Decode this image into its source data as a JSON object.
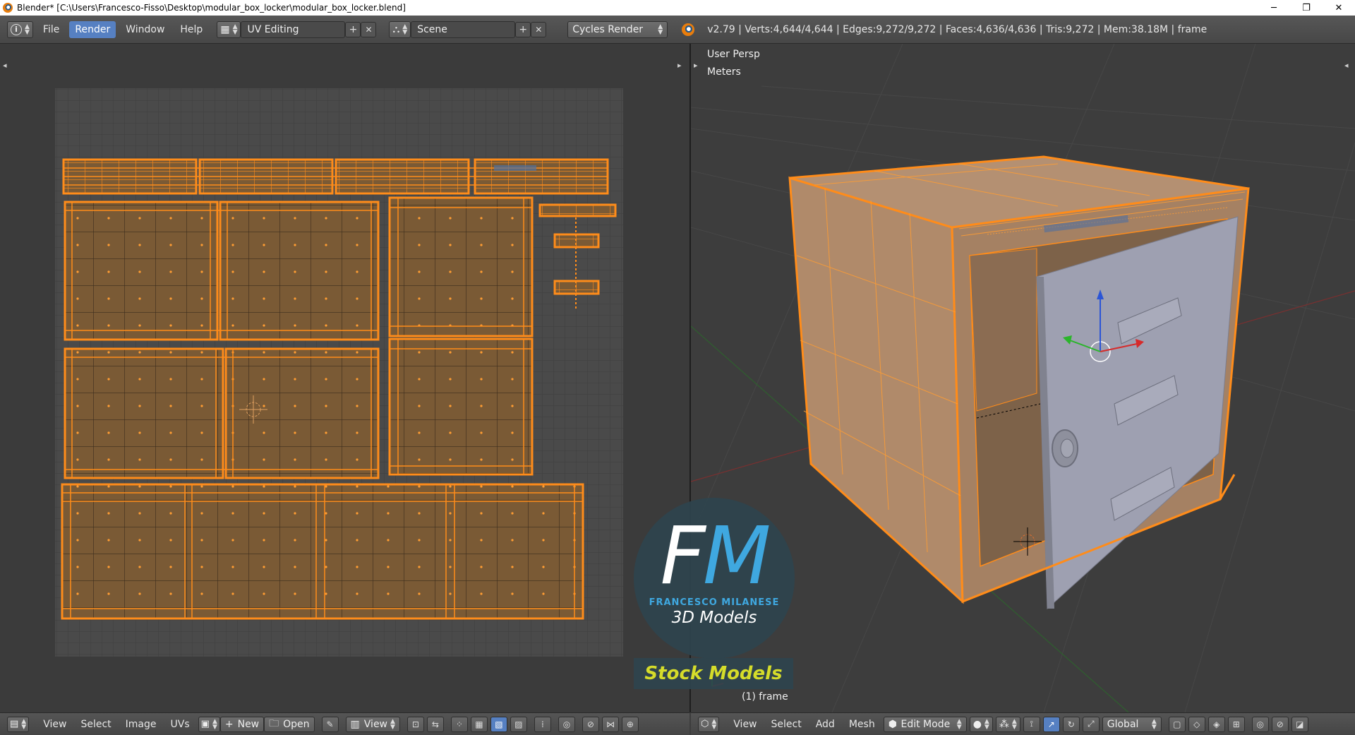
{
  "window": {
    "title": "Blender* [C:\\Users\\Francesco-Fisso\\Desktop\\modular_box_locker\\modular_box_locker.blend]",
    "controls": {
      "minimize": "─",
      "maximize": "❐",
      "close": "✕"
    }
  },
  "info_header": {
    "menus": [
      "File",
      "Render",
      "Window",
      "Help"
    ],
    "active_menu": "Render",
    "layout": "UV Editing",
    "scene": "Scene",
    "engine": "Cycles Render",
    "stats": "v2.79 | Verts:4,644/4,644 | Edges:9,272/9,272 | Faces:4,636/4,636 | Tris:9,272 | Mem:38.18M | frame",
    "add_symbol": "+",
    "remove_symbol": "✕"
  },
  "viewport": {
    "view_name": "User Persp",
    "units": "Meters",
    "object_label": "(1) frame"
  },
  "uv_header": {
    "menus": [
      "View",
      "Select",
      "Image",
      "UVs"
    ],
    "new_label": "New",
    "open_label": "Open",
    "view_label": "View"
  },
  "view3d_header": {
    "menus": [
      "View",
      "Select",
      "Add",
      "Mesh"
    ],
    "mode": "Edit Mode",
    "orientation": "Global"
  },
  "watermark": {
    "letter_f": "F",
    "letter_m": "M",
    "name": "FRANCESCO MILANESE",
    "subtitle": "3D Models",
    "banner": "Stock Models"
  },
  "colors": {
    "uv_orange": "#ff8c1a",
    "uv_fill": "#7a5a35",
    "selection_blue": "#5680c2",
    "door_gray": "#9ea0b1",
    "watermark_blue": "#3fa8e0",
    "watermark_yellow": "#d5dc2a"
  }
}
